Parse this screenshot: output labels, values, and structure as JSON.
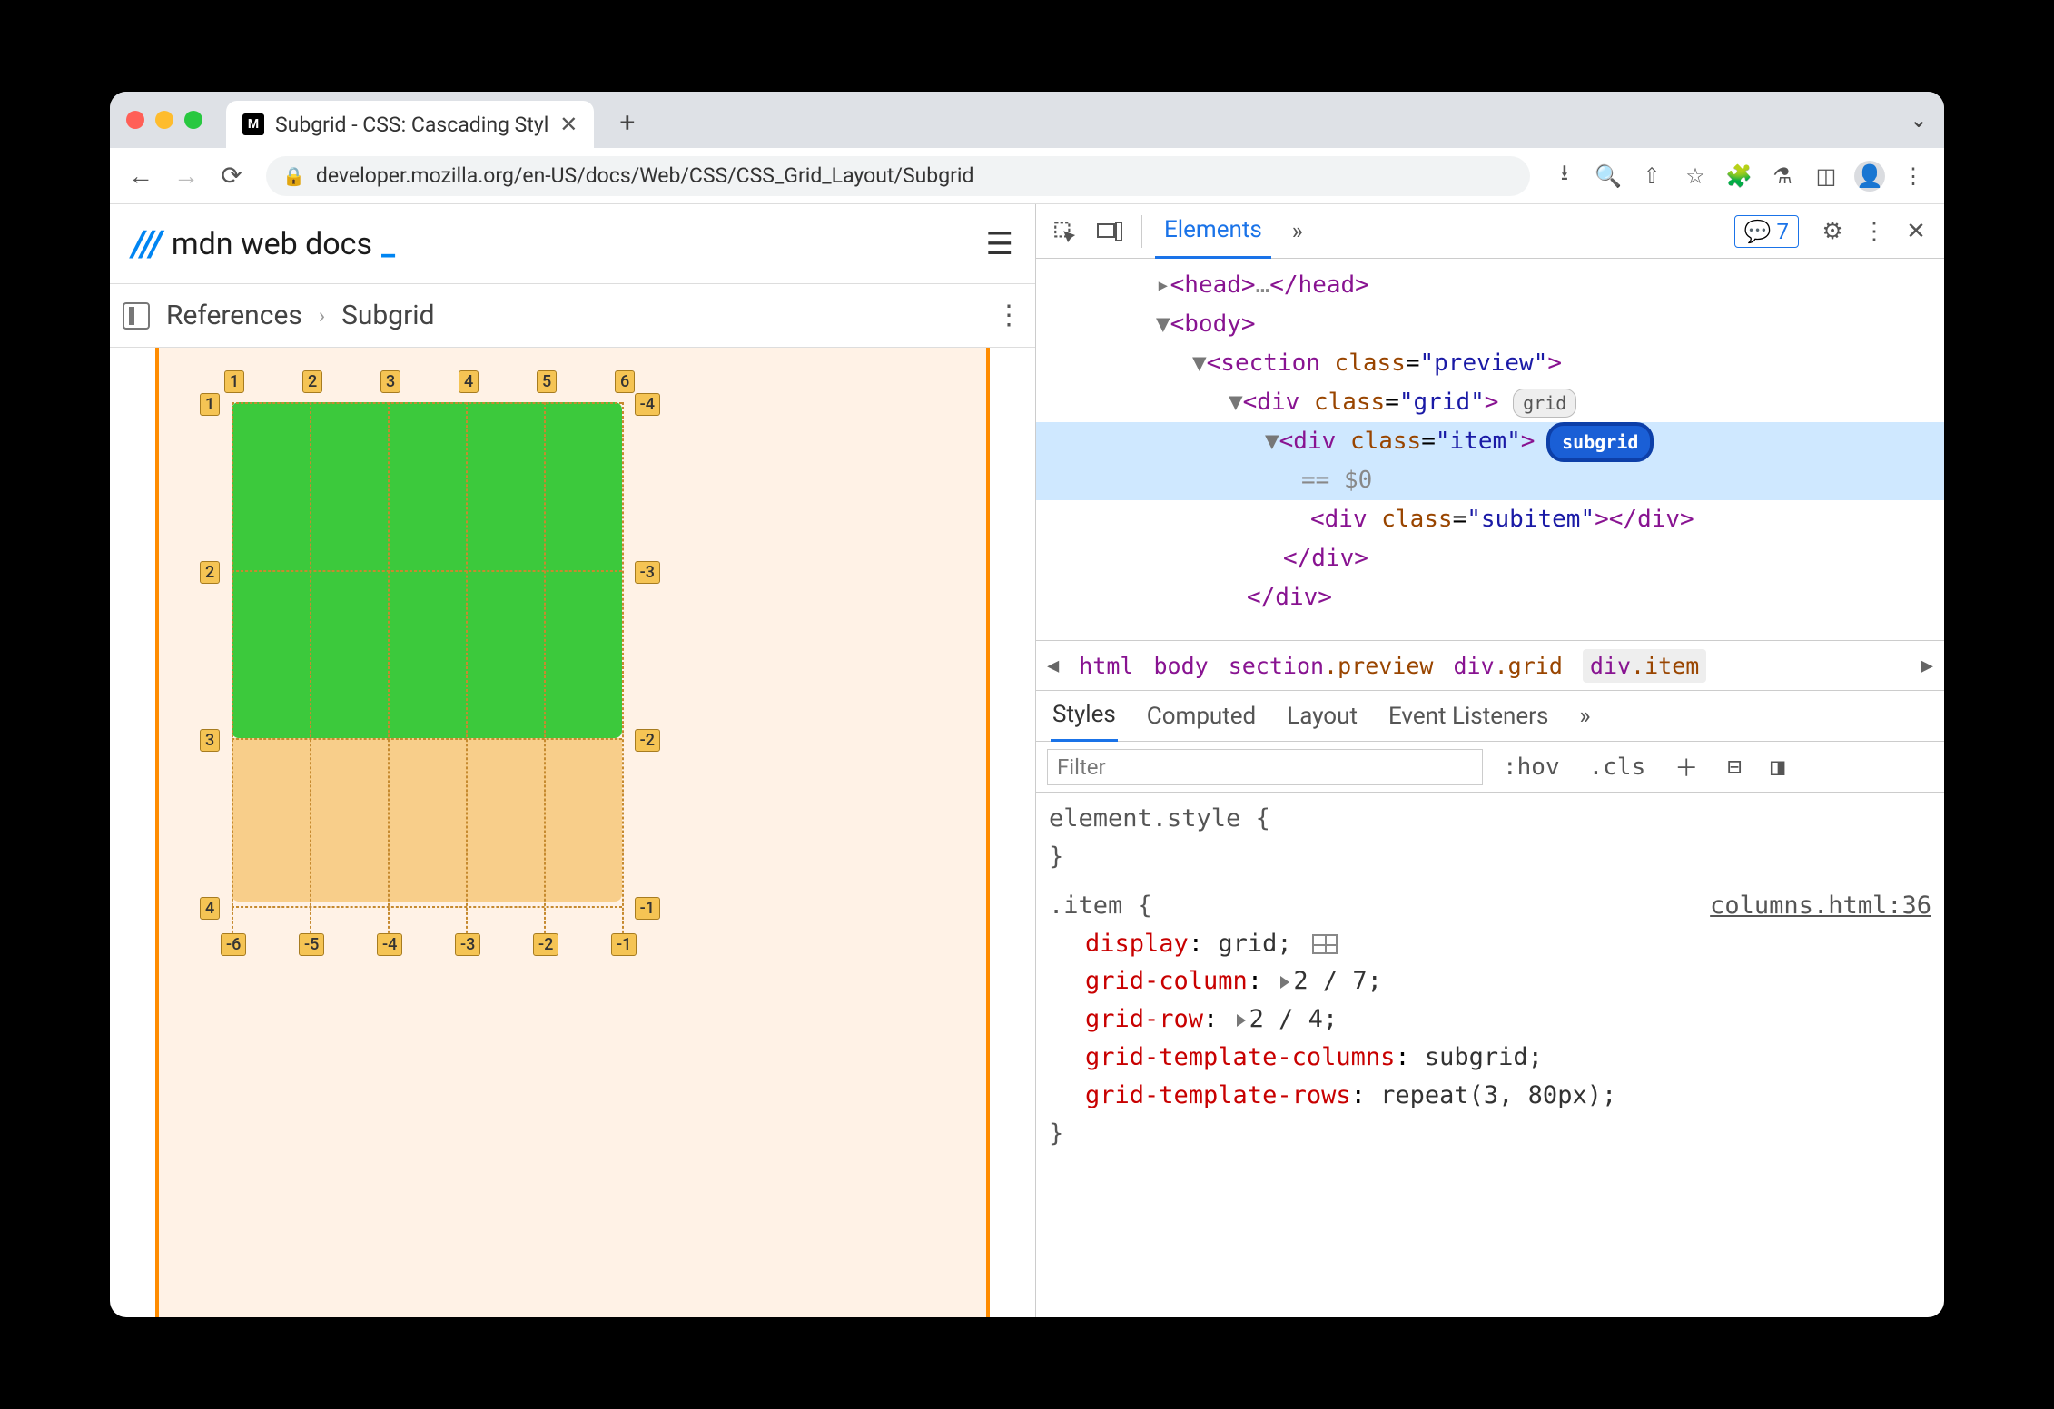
{
  "tab": {
    "title": "Subgrid - CSS: Cascading Styl"
  },
  "url": "developer.mozilla.org/en-US/docs/Web/CSS/CSS_Grid_Layout/Subgrid",
  "mdn": {
    "brand": "mdn web docs"
  },
  "breadcrumb": {
    "root": "References",
    "current": "Subgrid"
  },
  "gridLabels": {
    "topCols": [
      "1",
      "2",
      "3",
      "4",
      "5",
      "6"
    ],
    "leftRows": [
      "1",
      "2",
      "3",
      "4"
    ],
    "rightRowsNeg": [
      "-4",
      "-3",
      "-2",
      "-1"
    ],
    "bottomColsNeg": [
      "-6",
      "-5",
      "-4",
      "-3",
      "-2",
      "-1"
    ]
  },
  "devtools": {
    "tab": "Elements",
    "issuesCount": "7",
    "dom": {
      "head": "<head>…</head>",
      "body": "<body>",
      "section": "<section class=\"preview\">",
      "gridDiv": "<div class=\"grid\">",
      "gridBadge": "grid",
      "itemDiv": "<div class=\"item\">",
      "itemBadge": "subgrid",
      "eq": "== $0",
      "subitem": "<div class=\"subitem\"></div>",
      "closeDiv": "</div>",
      "closeDiv2": "</div>"
    },
    "crumbs": [
      "html",
      "body",
      "section.preview",
      "div.grid",
      "div.item"
    ],
    "styleTabs": [
      "Styles",
      "Computed",
      "Layout",
      "Event Listeners"
    ],
    "filterPlaceholder": "Filter",
    "hov": ":hov",
    "cls": ".cls",
    "elementStyle": "element.style {",
    "elementStyleClose": "}",
    "ruleSelector": ".item {",
    "ruleSource": "columns.html:36",
    "decls": [
      {
        "prop": "display",
        "val": "grid;",
        "icon": true
      },
      {
        "prop": "grid-column",
        "val": "2 / 7;",
        "tri": true
      },
      {
        "prop": "grid-row",
        "val": "2 / 4;",
        "tri": true
      },
      {
        "prop": "grid-template-columns",
        "val": "subgrid;"
      },
      {
        "prop": "grid-template-rows",
        "val": "repeat(3, 80px);"
      }
    ],
    "ruleClose": "}"
  }
}
